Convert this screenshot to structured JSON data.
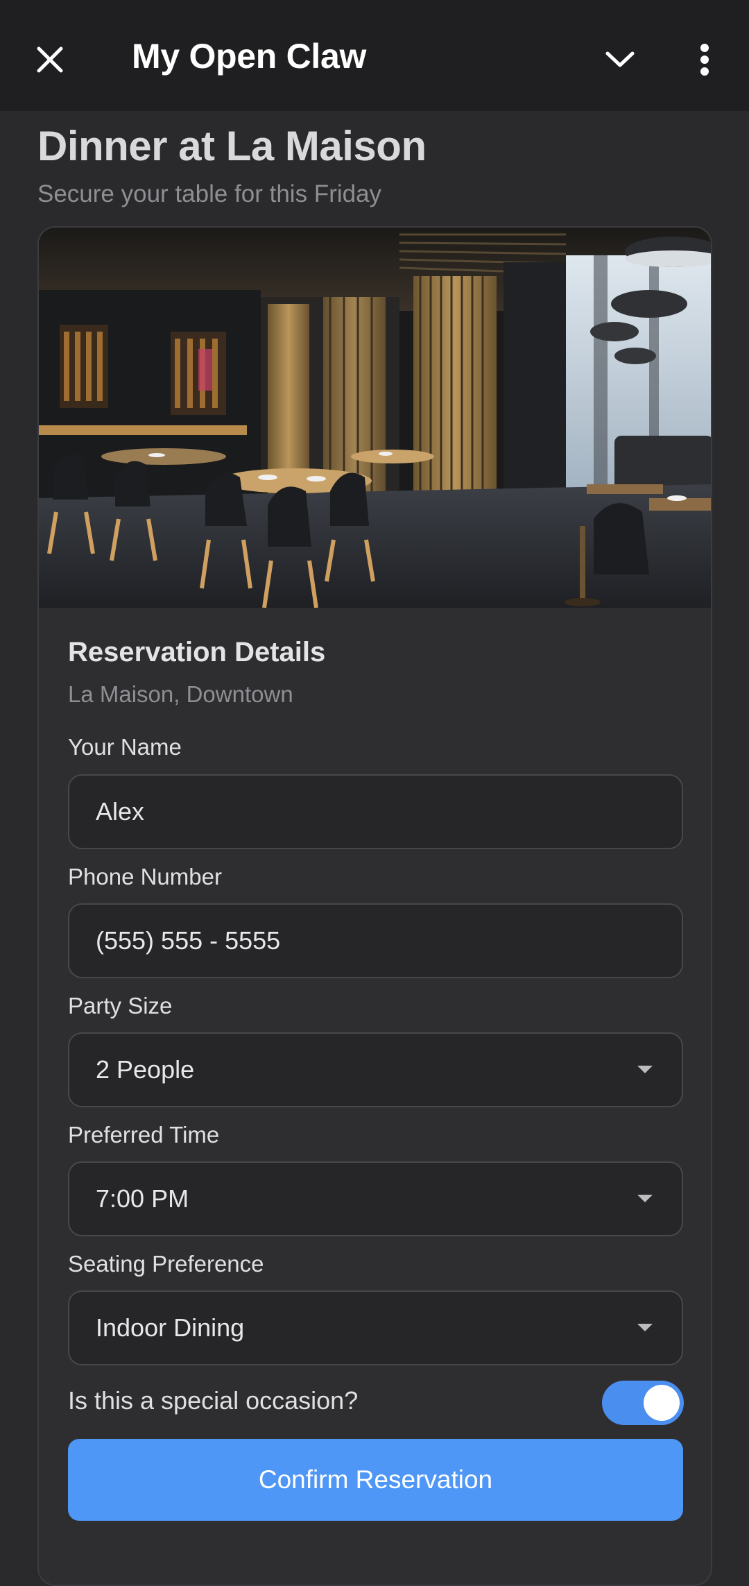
{
  "header": {
    "title": "My Open Claw",
    "close_icon": "close-icon",
    "collapse_icon": "chevron-down-icon",
    "more_icon": "more-vertical-icon"
  },
  "page": {
    "title": "Dinner at La Maison",
    "subtitle": "Secure your table for this Friday"
  },
  "card": {
    "image": "restaurant-interior-photo",
    "section_title": "Reservation Details",
    "section_subtitle": "La Maison, Downtown",
    "fields": {
      "name": {
        "label": "Your Name",
        "value": "Alex"
      },
      "phone": {
        "label": "Phone Number",
        "value": "(555) 555 - 5555"
      },
      "party_size": {
        "label": "Party Size",
        "value": "2 People"
      },
      "time": {
        "label": "Preferred Time",
        "value": "7:00 PM"
      },
      "seating": {
        "label": "Seating Preference",
        "value": "Indoor Dining"
      }
    },
    "special_occasion": {
      "label": "Is this a special occasion?",
      "on": true
    },
    "confirm_label": "Confirm Reservation"
  },
  "colors": {
    "accent": "#4f97f6",
    "toggle_on": "#4a8ef0",
    "background": "#2a2a2c",
    "topbar": "#1f1f21"
  }
}
